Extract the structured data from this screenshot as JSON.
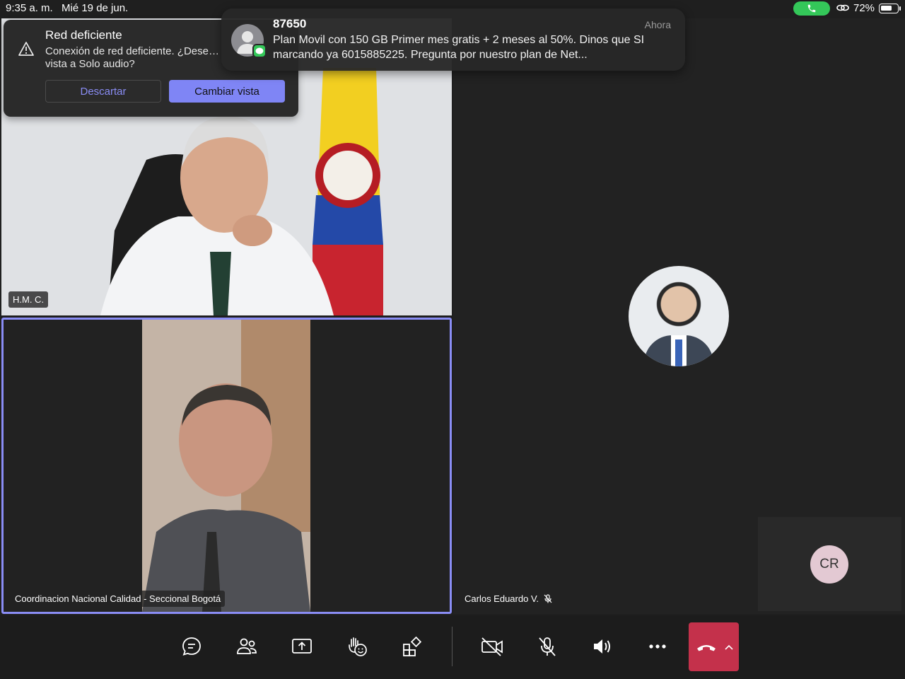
{
  "status_bar": {
    "time": "9:35 a. m.",
    "date": "Mié 19 de jun.",
    "battery_percent": "72%",
    "battery_level": 0.72,
    "call_indicator_color": "#34c759"
  },
  "notification": {
    "sender": "87650",
    "time": "Ahora",
    "message": "Plan Movil con 150 GB Primer mes gratis + 2 meses al 50%. Dinos que SI marcando ya 6015885225. Pregunta por nuestro plan de Net..."
  },
  "network_warning": {
    "title": "Red deficiente",
    "message": "Conexión de red deficiente. ¿Dese… vista a Solo audio?",
    "dismiss_label": "Descartar",
    "change_label": "Cambiar vista"
  },
  "participants": {
    "top_left": {
      "name": "H.M. C."
    },
    "bottom_left": {
      "name": "Coordinacion Nacional Calidad - Seccional Bogotá"
    },
    "right": {
      "name": "Carlos Eduardo V."
    },
    "small": {
      "initials": "CR"
    }
  },
  "toolbar": {
    "icons": [
      "chat-icon",
      "people-icon",
      "share-screen-icon",
      "reactions-icon",
      "apps-icon",
      "camera-off-icon",
      "mic-off-icon",
      "speaker-icon",
      "more-icon",
      "hang-up-icon"
    ],
    "accent_color": "#8a8df5",
    "hangup_color": "#c4314b"
  }
}
